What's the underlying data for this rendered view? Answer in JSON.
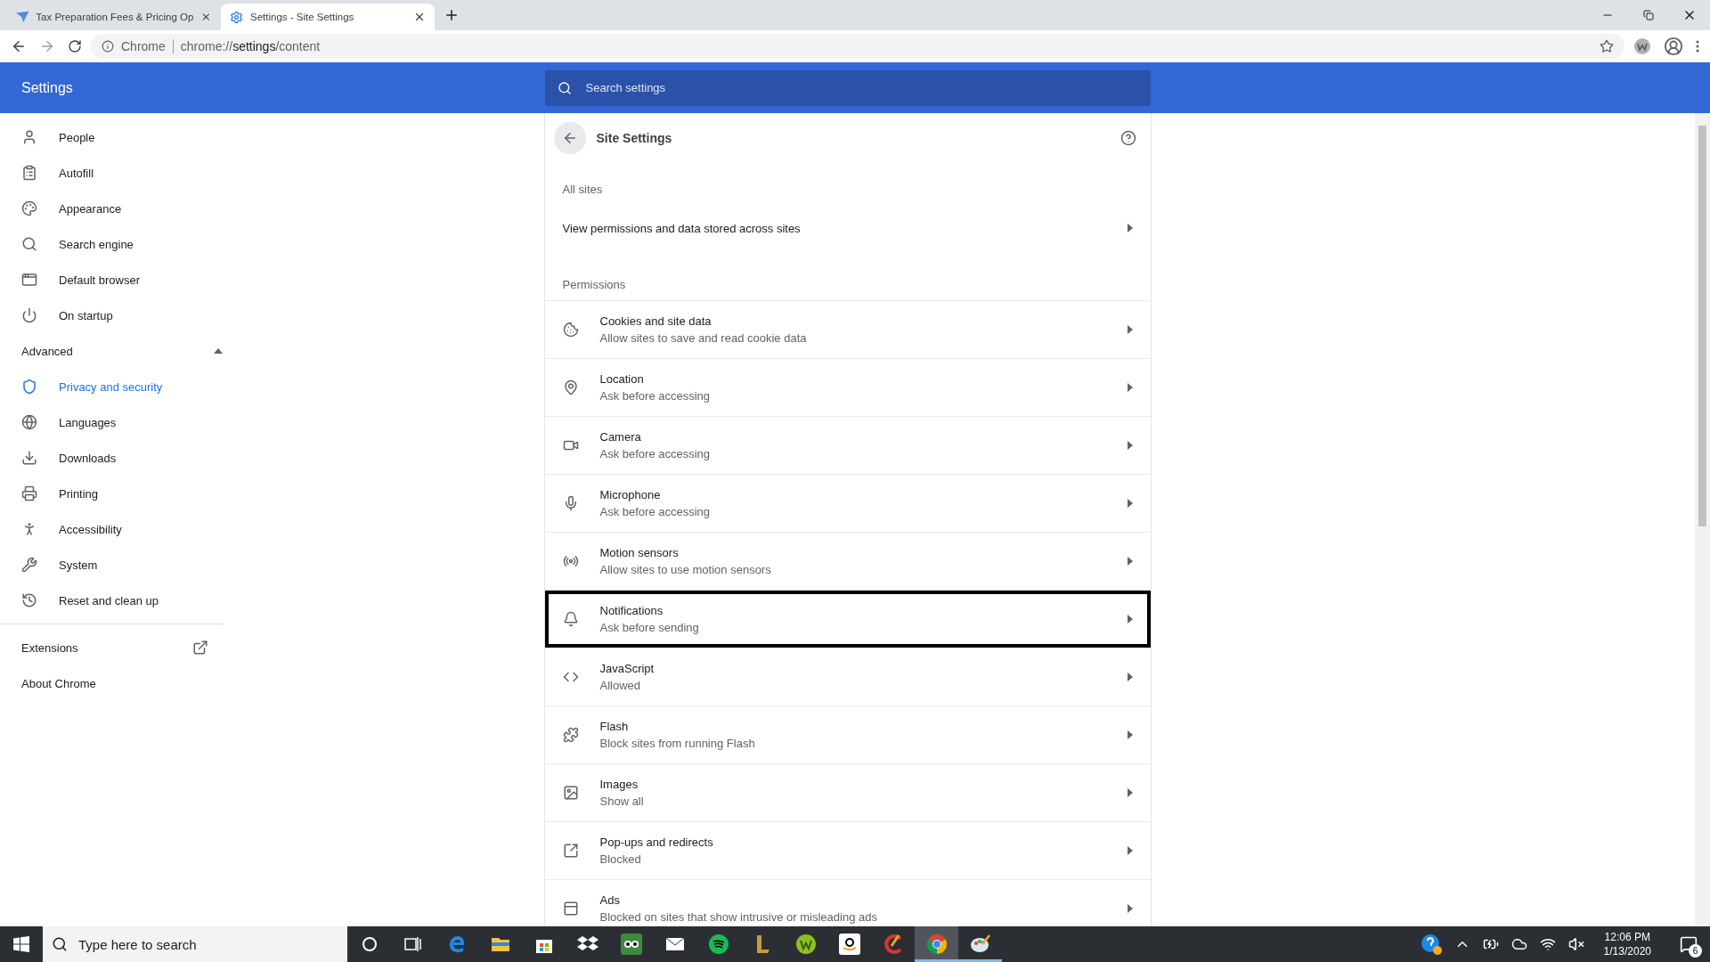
{
  "browser": {
    "tabs": [
      {
        "title": "Tax Preparation Fees & Pricing Op",
        "kind": "bird",
        "selected": false
      },
      {
        "title": "Settings - Site Settings",
        "kind": "gear",
        "selected": true
      }
    ],
    "address": {
      "chip": "Chrome",
      "url": "chrome://**settings**/content"
    }
  },
  "header": {
    "title": "Settings",
    "search": {
      "placeholder": "Search settings"
    }
  },
  "sidebar": {
    "items": [
      {
        "label": "People",
        "kind": "person",
        "selected": false
      },
      {
        "label": "Autofill",
        "kind": "clipboard",
        "selected": false
      },
      {
        "label": "Appearance",
        "kind": "palette",
        "selected": false
      },
      {
        "label": "Search engine",
        "kind": "search",
        "selected": false
      },
      {
        "label": "Default browser",
        "kind": "browser",
        "selected": false
      },
      {
        "label": "On startup",
        "kind": "power",
        "selected": false
      }
    ],
    "advanced": {
      "label": "Advanced",
      "expanded": true,
      "items": [
        {
          "label": "Privacy and security",
          "kind": "shield",
          "selected": true
        },
        {
          "label": "Languages",
          "kind": "globe",
          "selected": false
        },
        {
          "label": "Downloads",
          "kind": "download",
          "selected": false
        },
        {
          "label": "Printing",
          "kind": "printer",
          "selected": false
        },
        {
          "label": "Accessibility",
          "kind": "accessibility",
          "selected": false
        },
        {
          "label": "System",
          "kind": "wrench",
          "selected": false
        },
        {
          "label": "Reset and clean up",
          "kind": "history",
          "selected": false
        }
      ]
    },
    "extensions": "Extensions",
    "about": "About Chrome"
  },
  "panel": {
    "title": "Site Settings",
    "all_sites_heading": "All sites",
    "all_sites_link": "View permissions and data stored across sites",
    "permissions_heading": "Permissions",
    "permissions": [
      {
        "title": "Cookies and site data",
        "subtitle": "Allow sites to save and read cookie data",
        "kind": "cookie",
        "focused": false
      },
      {
        "title": "Location",
        "subtitle": "Ask before accessing",
        "kind": "location",
        "focused": false
      },
      {
        "title": "Camera",
        "subtitle": "Ask before accessing",
        "kind": "camera",
        "focused": false
      },
      {
        "title": "Microphone",
        "subtitle": "Ask before accessing",
        "kind": "microphone",
        "focused": false
      },
      {
        "title": "Motion sensors",
        "subtitle": "Allow sites to use motion sensors",
        "kind": "motion",
        "focused": false
      },
      {
        "title": "Notifications",
        "subtitle": "Ask before sending",
        "kind": "bell",
        "focused": true
      },
      {
        "title": "JavaScript",
        "subtitle": "Allowed",
        "kind": "code",
        "focused": false
      },
      {
        "title": "Flash",
        "subtitle": "Block sites from running Flash",
        "kind": "puzzle",
        "focused": false
      },
      {
        "title": "Images",
        "subtitle": "Show all",
        "kind": "image",
        "focused": false
      },
      {
        "title": "Pop-ups and redirects",
        "subtitle": "Blocked",
        "kind": "popup",
        "focused": false
      },
      {
        "title": "Ads",
        "subtitle": "Blocked on sites that show intrusive or misleading ads",
        "kind": "ads",
        "focused": false
      }
    ]
  },
  "taskbar": {
    "search": {
      "placeholder": "Type here to search"
    },
    "apps": [
      {
        "kind": "edge",
        "running": false,
        "selected": false
      },
      {
        "kind": "folder",
        "running": false,
        "selected": false
      },
      {
        "kind": "store",
        "running": false,
        "selected": false
      },
      {
        "kind": "dropbox",
        "running": false,
        "selected": false
      },
      {
        "kind": "owl",
        "running": false,
        "selected": false
      },
      {
        "kind": "mail",
        "running": false,
        "selected": false
      },
      {
        "kind": "spotify",
        "running": false,
        "selected": false
      },
      {
        "kind": "game",
        "running": false,
        "selected": false
      },
      {
        "kind": "w",
        "running": false,
        "selected": false
      },
      {
        "kind": "amazon",
        "running": false,
        "selected": false
      },
      {
        "kind": "cleaner",
        "running": false,
        "selected": false
      },
      {
        "kind": "chrome",
        "running": true,
        "selected": true
      },
      {
        "kind": "paint",
        "running": true,
        "selected": false
      }
    ],
    "time": "12:06 PM",
    "date": "1/13/2020",
    "notifications": "6"
  }
}
